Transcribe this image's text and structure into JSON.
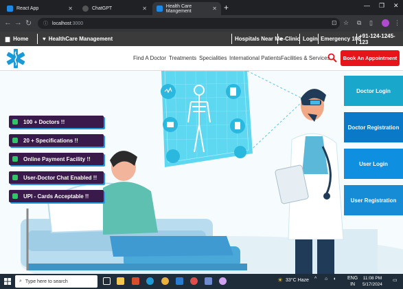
{
  "browser": {
    "tabs": [
      {
        "label": "React App",
        "color": "#1e88e5"
      },
      {
        "label": "ChatGPT",
        "color": "#3c3c3c"
      },
      {
        "label": "Health Care Mangement",
        "color": "#1e88e5"
      }
    ],
    "url_host": "localhost",
    "url_port": ":3000"
  },
  "topnav": {
    "home": "Home",
    "brand": "HealthCare Management",
    "links": [
      "Hospitals Near Me",
      "e-Clinic",
      "Login",
      "Emergency 108",
      "+91-124-1245-123"
    ]
  },
  "header": {
    "menu": [
      "Find A Doctor",
      "Treatments",
      "Specialities",
      "International Patients",
      "Facilities & Services"
    ],
    "appointment_button": "Book An Appointment"
  },
  "features": [
    "100 + Doctors !!",
    "20 + Specifications !!",
    "Online Payment Facility !!",
    "User-Doctor Chat Enabled !!",
    "UPI - Cards Acceptable !!"
  ],
  "side_buttons": [
    {
      "label": "Doctor Login",
      "color": "#1aa7cc"
    },
    {
      "label": "Doctor Registration",
      "color": "#0a79c8"
    },
    {
      "label": "User Login",
      "color": "#0f8fe0"
    },
    {
      "label": "User Registration",
      "color": "#168cd6"
    }
  ],
  "taskbar": {
    "search_placeholder": "Type here to search",
    "weather": "33°C  Haze",
    "lang": "ENG",
    "region": "IN",
    "time": "11:08 PM",
    "date": "5/17/2024"
  },
  "colors": {
    "accent_red": "#e8141c",
    "feature_bg": "#3a1a4a",
    "topnav_bg": "#3b3b3b"
  }
}
